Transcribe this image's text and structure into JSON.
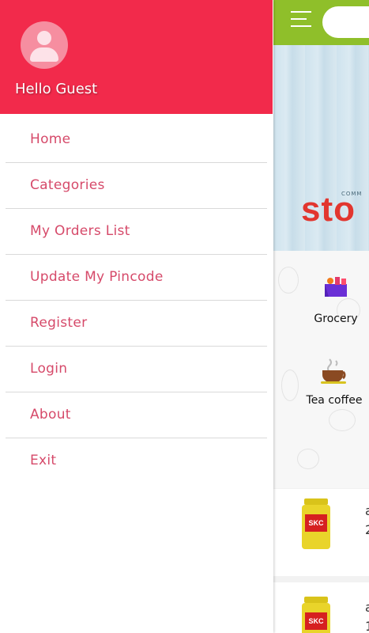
{
  "drawer": {
    "greeting": "Hello Guest",
    "items": [
      {
        "label": "Home"
      },
      {
        "label": "Categories"
      },
      {
        "label": "My Orders List"
      },
      {
        "label": "Update My Pincode"
      },
      {
        "label": "Register"
      },
      {
        "label": "Login"
      },
      {
        "label": "About"
      },
      {
        "label": "Exit"
      }
    ]
  },
  "app": {
    "banner_small": "COMM",
    "banner_big": "sto",
    "categories": [
      {
        "label": "Grocery",
        "icon": "grocery-basket-icon"
      },
      {
        "label": "Tea coffee",
        "icon": "tea-cup-icon"
      }
    ],
    "products": [
      {
        "brand": "SKC",
        "line1": "a",
        "line2": "2"
      },
      {
        "brand": "SKC",
        "line1": "a",
        "line2": "1"
      }
    ]
  },
  "colors": {
    "drawer_header": "#f22a4b",
    "menu_text": "#d64a6a",
    "topbar": "#8fbf2a",
    "banner_text": "#e2362f"
  }
}
